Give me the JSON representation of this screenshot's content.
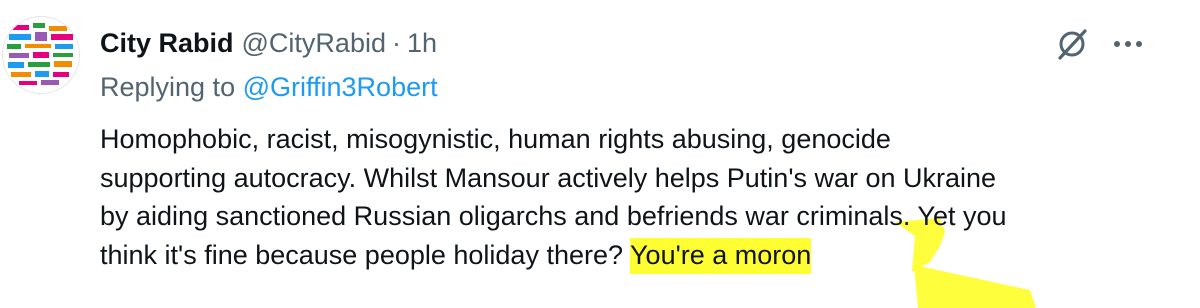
{
  "colors": {
    "text": "#0f1419",
    "secondary": "#536471",
    "link": "#1d9bf0",
    "highlight": "#fefe33"
  },
  "tweet": {
    "display_name": "City Rabid",
    "handle": "@CityRabid",
    "separator": "·",
    "time": "1h",
    "reply_prefix": "Replying to",
    "reply_to": "@Griffin3Robert",
    "lines": [
      "Homophobic, racist, misogynistic, human rights abusing, genocide",
      "supporting autocracy. Whilst Mansour actively helps Putin's war on Ukraine",
      "by aiding sanctioned Russian oligarchs and befriends war criminals. Yet you"
    ],
    "last_line_plain": "think it's fine because people holiday there?",
    "highlighted_text": "You're a moron"
  },
  "icons": {
    "avatar": "avatar-logo-icon",
    "grok": "grok-icon",
    "more": "more-icon"
  }
}
